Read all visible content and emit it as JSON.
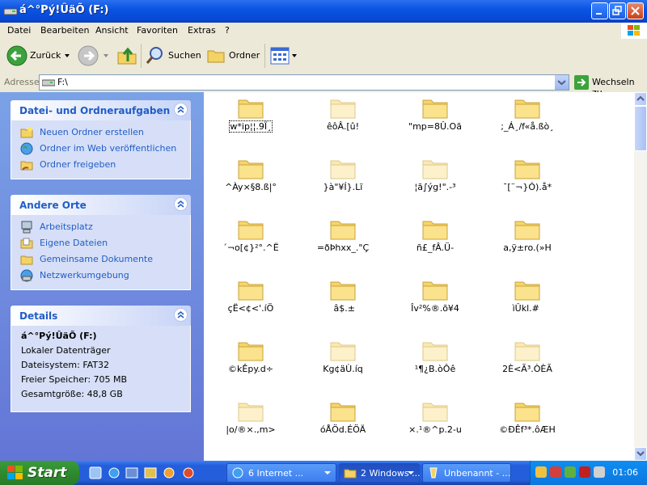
{
  "window": {
    "title": "á\u0010^°Pý!\u0010ÛäÕ (F:)"
  },
  "menu": [
    "Datei",
    "Bearbeiten",
    "Ansicht",
    "Favoriten",
    "Extras",
    "?"
  ],
  "toolbar": {
    "back": "Zurück",
    "search": "Suchen",
    "folders": "Ordner"
  },
  "address": {
    "label": "Adresse",
    "value": "F:\\",
    "go": "Wechseln zu"
  },
  "tasks_panel": {
    "title": "Datei- und Ordneraufgaben",
    "items": [
      "Neuen Ordner erstellen",
      "Ordner im Web veröffentlichen",
      "Ordner freigeben"
    ]
  },
  "places_panel": {
    "title": "Andere Orte",
    "items": [
      "Arbeitsplatz",
      "Eigene Dateien",
      "Gemeinsame Dokumente",
      "Netzwerkumgebung"
    ]
  },
  "details_panel": {
    "title": "Details",
    "name": "á\u0010^°Pý!\u0010ÛäÕ (F:)",
    "type": "Lokaler Datenträger",
    "filesystem": "Dateisystem: FAT32",
    "free": "Freier Speicher: 705 MB",
    "total": "Gesamtgröße: 48,8 GB"
  },
  "folders": [
    "w*ip¦¦\u0010.9Ï¸",
    "\u0010\u0010\u0010ê\u0010\u0010ôÂ.[û!",
    "\"mp\u0010=\u00108Û.O\u0010ã",
    ";_Á¸/f«å.ßò¸",
    "^Ày×§\u00108\u0010.ß|°",
    "}à\"¥Í\u0010}.Lï",
    "¦ã∫\u0010ýg!\".-³\u0010",
    "¯[¨¬}Ó)\u0010.å\u0010*",
    "´¬o[¢}²°.^Ë\u0010",
    "=ðÞhxx\u0010_.\u0010\"Ç",
    "\u0010\u0010ñ£_\u0010fÂ.Ü\u0010-",
    "\u0010a\u0010,ÿ±ro.(»H",
    "\u0010çË\u0010<¢<'.íÖ\u0010",
    "\u0010\u0010 \u0010\u0010â$\u0010.\u0010±\u0010",
    "\u0010Îv²\u0010%®\u0010.õ¥4",
    "\u0010ìÛ\u0010\u0010kl\u0010.# \u0010",
    "\u0010©\u0010kÊp\u0010y.d÷\u0010",
    "\u0010Kg¢\u0010äÙ\u0010.í\u0010q",
    "\u0010¹\u0010¶\u0010¿B.òÔê",
    "\u00102È<Ã\u0010\u0010³.ÒÈÃ",
    "\u0010|o/®\u0010\u0010×.,m>",
    "\u0010óÅ\u0010Öd\u0010\u0010.ÉÖÄ",
    "×.¹®\u0010^p\u0010.2-u",
    "©\u0010ÐÊf\u0010³*.ôÆH"
  ],
  "taskbar": {
    "start": "Start",
    "buttons": [
      "6 Internet ...",
      "2 Windows ...",
      "Unbenannt - ..."
    ],
    "clock": "01:06"
  }
}
